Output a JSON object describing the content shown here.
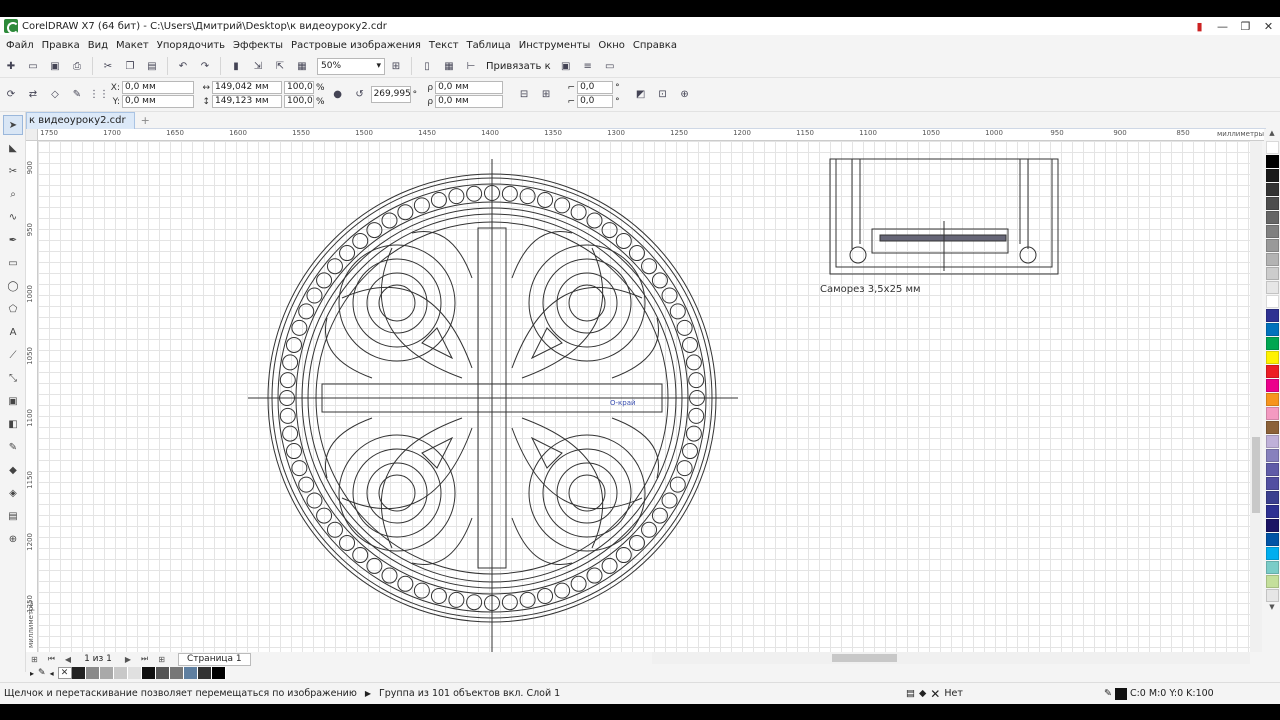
{
  "window": {
    "title": "CorelDRAW X7 (64 бит) - C:\\Users\\Дмитрий\\Desktop\\к видеоуроку2.cdr",
    "controls": [
      "—",
      "❐",
      "✕"
    ]
  },
  "menu": [
    "Файл",
    "Правка",
    "Вид",
    "Макет",
    "Упорядочить",
    "Эффекты",
    "Растровые изображения",
    "Текст",
    "Таблица",
    "Инструменты",
    "Окно",
    "Справка"
  ],
  "toolbar": {
    "zoom": "50%",
    "snap_label": "Привязать к"
  },
  "propbar": {
    "x": "0,0 мм",
    "y": "0,0 мм",
    "width": "149,042 мм",
    "height": "149,123 мм",
    "scale_w": "100,0",
    "scale_h": "100,0",
    "percent": "%",
    "angle": "269,995",
    "deg": "°",
    "x2": "0,0 мм",
    "y2": "0,0 мм",
    "skew1": "0,0",
    "skew2": "0,0",
    "x_label": "X:",
    "y_label": "Y:"
  },
  "document": {
    "tab_name": "к видеоуроку2.cdr",
    "add_tab": "+"
  },
  "rulers": {
    "h_ticks": [
      "1750",
      "1700",
      "1650",
      "1600",
      "1550",
      "1500",
      "1450",
      "1400",
      "1350",
      "1300",
      "1250",
      "1200",
      "1150",
      "1100",
      "1050",
      "1000",
      "950",
      "900",
      "850"
    ],
    "v_ticks": [
      "900",
      "950",
      "1000",
      "1050",
      "1100",
      "1150",
      "1200",
      "1250"
    ],
    "units": "миллиметры"
  },
  "canvas": {
    "caption": "Саморез 3,5х25 мм",
    "node_label": "О-край"
  },
  "pagenav": {
    "page_count": "1 из 1",
    "page_tab": "Страница 1"
  },
  "doc_palette_colors": [
    "#222222",
    "#8a8a8a",
    "#a9a9a9",
    "#c8c8c8",
    "#e0e0e0",
    "#111111",
    "#555555",
    "#777777",
    "#5f7fa0",
    "#333333",
    "#000000"
  ],
  "palette_colors": [
    "#ffffff",
    "#000000",
    "#1a1a1a",
    "#333333",
    "#4d4d4d",
    "#666666",
    "#808080",
    "#999999",
    "#b3b3b3",
    "#cccccc",
    "#e6e6e6",
    "#ffffff",
    "#2e3192",
    "#0072bc",
    "#00a651",
    "#fff200",
    "#ed1c24",
    "#ec008c",
    "#f7941d",
    "#f49ac1",
    "#8c6239",
    "#bfb1d9",
    "#8781bd",
    "#605ca8",
    "#524fa1",
    "#3b3f8f",
    "#2e3192",
    "#1b1464",
    "#0054a6",
    "#00aeef",
    "#7accc8",
    "#c4df9b",
    "#e6e6e6"
  ],
  "status": {
    "hint": "Щелчок и перетаскивание позволяет перемещаться по изображению",
    "object_info": "Группа из 101 объектов вкл. Слой 1",
    "fill": "Нет",
    "outline": "C:0 M:0 Y:0 K:100"
  }
}
